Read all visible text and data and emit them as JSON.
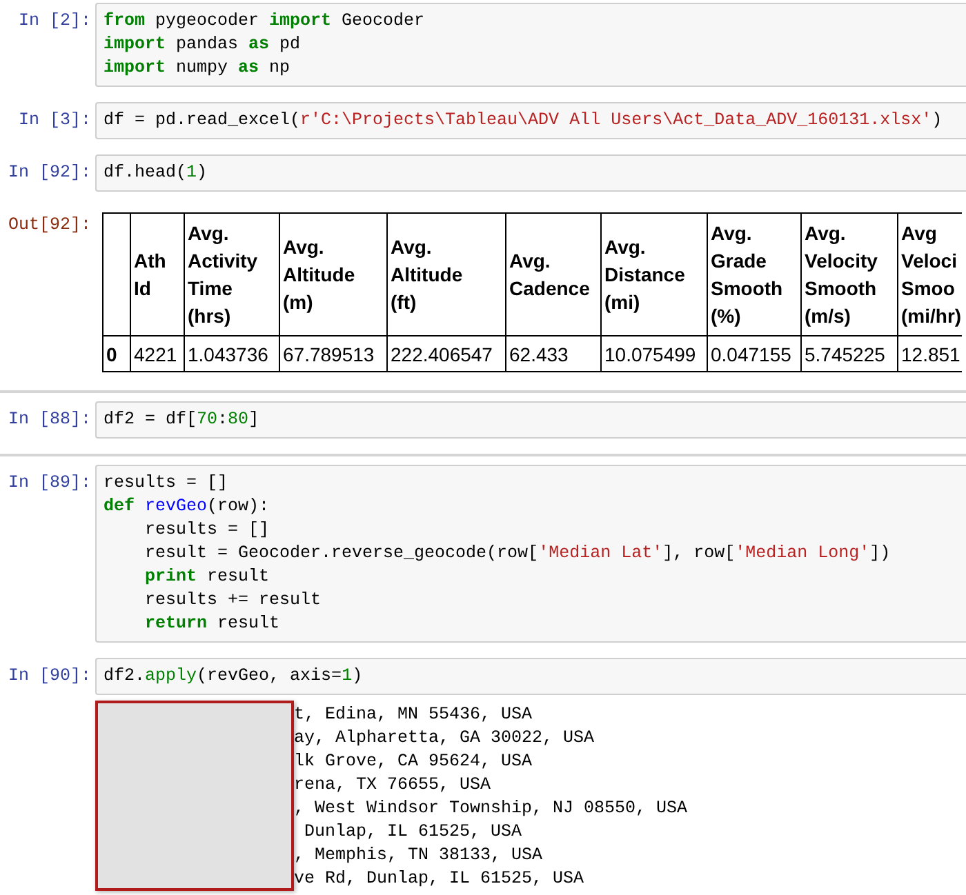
{
  "cells": [
    {
      "kind": "code",
      "prompt": "In [2]:",
      "lines": [
        [
          {
            "t": "from",
            "kind": "kw"
          },
          {
            "t": " pygeocoder ",
            "kind": "plain"
          },
          {
            "t": "import",
            "kind": "kw"
          },
          {
            "t": " Geocoder",
            "kind": "plain"
          }
        ],
        [
          {
            "t": "import",
            "kind": "kw"
          },
          {
            "t": " pandas ",
            "kind": "plain"
          },
          {
            "t": "as",
            "kind": "kw"
          },
          {
            "t": " pd",
            "kind": "plain"
          }
        ],
        [
          {
            "t": "import",
            "kind": "kw"
          },
          {
            "t": " numpy ",
            "kind": "plain"
          },
          {
            "t": "as",
            "kind": "kw"
          },
          {
            "t": " np",
            "kind": "plain"
          }
        ]
      ]
    },
    {
      "kind": "code",
      "prompt": "In [3]:",
      "lines": [
        [
          {
            "t": "df = pd.read_excel(",
            "kind": "plain"
          },
          {
            "t": "r'C:\\Projects\\Tableau\\ADV All Users\\Act_Data_ADV_160131.xlsx'",
            "kind": "str"
          },
          {
            "t": ")",
            "kind": "plain"
          }
        ]
      ]
    },
    {
      "kind": "code",
      "prompt": "In [92]:",
      "lines": [
        [
          {
            "t": "df.head(",
            "kind": "plain"
          },
          {
            "t": "1",
            "kind": "num"
          },
          {
            "t": ")",
            "kind": "plain"
          }
        ]
      ]
    },
    {
      "kind": "table",
      "prompt": "Out[92]:",
      "columns": [
        "",
        "Ath\nId",
        "Avg.\nActivity\nTime\n(hrs)",
        "Avg.\nAltitude\n(m)",
        "Avg.\nAltitude\n(ft)",
        "Avg.\nCadence",
        "Avg.\nDistance\n(mi)",
        "Avg.\nGrade\nSmooth\n(%)",
        "Avg.\nVelocity\nSmooth\n(m/s)",
        "Avg\nVeloci\nSmoo\n(mi/hr)"
      ],
      "rows": [
        [
          "0",
          "4221",
          "1.043736",
          "67.789513",
          "222.406547",
          "62.433",
          "10.075499",
          "0.047155",
          "5.745225",
          "12.851"
        ]
      ]
    },
    {
      "kind": "divider"
    },
    {
      "kind": "code",
      "prompt": "In [88]:",
      "lines": [
        [
          {
            "t": "df2 = df[",
            "kind": "plain"
          },
          {
            "t": "70",
            "kind": "num"
          },
          {
            "t": ":",
            "kind": "plain"
          },
          {
            "t": "80",
            "kind": "num"
          },
          {
            "t": "]",
            "kind": "plain"
          }
        ]
      ]
    },
    {
      "kind": "divider"
    },
    {
      "kind": "code",
      "prompt": "In [89]:",
      "lines": [
        [
          {
            "t": "results = []",
            "kind": "plain"
          }
        ],
        [
          {
            "t": "def",
            "kind": "kw"
          },
          {
            "t": " revGeo",
            "kind": "def"
          },
          {
            "t": "(row):",
            "kind": "plain"
          }
        ],
        [
          {
            "t": "    results = []",
            "kind": "plain"
          }
        ],
        [
          {
            "t": "    result = Geocoder.reverse_geocode(row[",
            "kind": "plain"
          },
          {
            "t": "'Median Lat'",
            "kind": "str"
          },
          {
            "t": "], row[",
            "kind": "plain"
          },
          {
            "t": "'Median Long'",
            "kind": "str"
          },
          {
            "t": "])",
            "kind": "plain"
          }
        ],
        [
          {
            "t": "    print",
            "kind": "kw"
          },
          {
            "t": " result",
            "kind": "plain"
          }
        ],
        [
          {
            "t": "    results += result",
            "kind": "plain"
          }
        ],
        [
          {
            "t": "    return",
            "kind": "kw"
          },
          {
            "t": " result",
            "kind": "plain"
          }
        ]
      ]
    },
    {
      "kind": "code",
      "prompt": "In [90]:",
      "lines": [
        [
          {
            "t": "df2.",
            "kind": "plain"
          },
          {
            "t": "apply",
            "kind": "call"
          },
          {
            "t": "(revGeo, axis=",
            "kind": "plain"
          },
          {
            "t": "1",
            "kind": "num"
          },
          {
            "t": ")",
            "kind": "plain"
          }
        ]
      ]
    },
    {
      "kind": "stream",
      "redacted": true,
      "lines": [
        "t, Edina, MN 55436, USA",
        "ay, Alpharetta, GA 30022, USA",
        "lk Grove, CA 95624, USA",
        "rena, TX 76655, USA",
        ", West Windsor Township, NJ 08550, USA",
        " Dunlap, IL 61525, USA",
        ", Memphis, TN 38133, USA",
        "ve Rd, Dunlap, IL 61525, USA"
      ]
    }
  ]
}
